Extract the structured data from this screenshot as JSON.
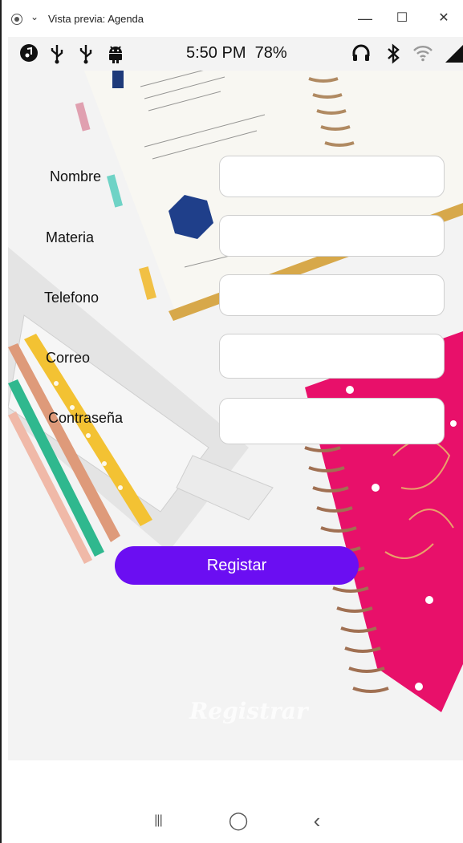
{
  "window": {
    "title": "Vista previa: Agenda",
    "minimize": "—",
    "maximize": "☐",
    "close": "✕"
  },
  "status_bar": {
    "time": "5:50 PM",
    "battery": "78%",
    "icons_left": [
      "music-icon",
      "usb-icon",
      "usb-icon",
      "android-icon"
    ],
    "icons_right": [
      "headphones-icon",
      "bluetooth-icon",
      "wifi-icon",
      "signal-icon"
    ]
  },
  "form": {
    "fields": [
      {
        "label": "Nombre",
        "value": ""
      },
      {
        "label": "Materia",
        "value": ""
      },
      {
        "label": "Telefono",
        "value": ""
      },
      {
        "label": "Correo",
        "value": ""
      },
      {
        "label": "Contraseña",
        "value": ""
      }
    ],
    "submit_label": "Registar",
    "background_text": "Registrar"
  },
  "nav_bar": {
    "recents": "|||",
    "home": "◯",
    "back": "‹"
  },
  "colors": {
    "button": "#6b0ef2",
    "notebook_pink": "#e8106a"
  }
}
